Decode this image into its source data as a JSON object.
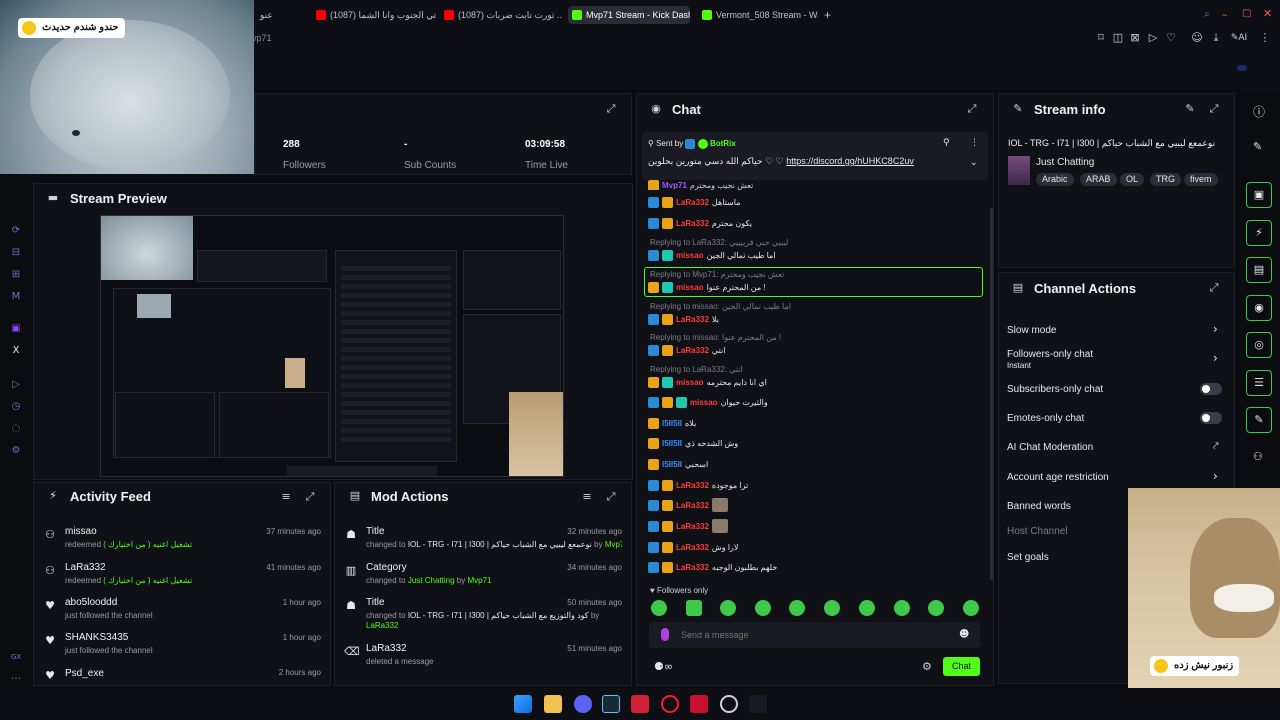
{
  "tabs": [
    {
      "label": "عنو"
    },
    {
      "label": "(1087) اتي الجنوب وانا الشما"
    },
    {
      "label": "(1087) ثورت تابت ضربات ..."
    },
    {
      "label": "Mvp71 Stream - Kick Dash"
    },
    {
      "label": "Vermont_508 Stream - Wa"
    }
  ],
  "url_fragment": "vp71",
  "webcam": {
    "caption": "حندو شندم حديدث"
  },
  "stats": {
    "followers_value": "288",
    "followers_label": "Followers",
    "subs_value": "-",
    "subs_label": "Sub Counts",
    "time_value": "03:09:58",
    "time_label": "Time Live"
  },
  "preview": {
    "title": "Stream Preview"
  },
  "activity": {
    "title": "Activity Feed",
    "items": [
      {
        "user": "missao",
        "action": "redeemed",
        "reward": "تشغيل اغنيه ( من اختيارك )",
        "time": "37 minutes ago"
      },
      {
        "user": "LaRa332",
        "action": "redeemed",
        "reward": "تشغيل اغنيه ( من اختيارك )",
        "time": "41 minutes ago"
      },
      {
        "user": "abo5looddd",
        "action": "just followed the channel",
        "reward": "",
        "time": "1 hour ago"
      },
      {
        "user": "SHANKS3435",
        "action": "just followed the channel",
        "reward": "",
        "time": "1 hour ago"
      },
      {
        "user": "Psd_exe",
        "action": "",
        "reward": "",
        "time": "2 hours ago"
      }
    ]
  },
  "mod": {
    "title": "Mod Actions",
    "items": [
      {
        "head": "Title",
        "pre": "changed to",
        "detail": "IOL - TRG - I71 | I300 | نوعمعع ليبيي مع الشباب حياكم",
        "by": "by",
        "who": "Mvp71",
        "time": "32 minutes ago"
      },
      {
        "head": "Category",
        "pre": "changed to",
        "detail": "Just Chatting",
        "by": "by",
        "who": "Mvp71",
        "time": "34 minutes ago"
      },
      {
        "head": "Title",
        "pre": "changed to",
        "detail": "IOL - TRG - I71 | I300 | كود والتوزيع مع الشباب حياكم",
        "by": "by",
        "who": "LaRa332",
        "time": "50 minutes ago"
      },
      {
        "head": "LaRa332",
        "pre": "deleted a message",
        "detail": "",
        "by": "",
        "who": "",
        "time": "51 minutes ago"
      }
    ]
  },
  "chat": {
    "title": "Chat",
    "pinned_label": "Sent by",
    "pinned_user": "BotRix",
    "pinned_text": "حياكم الله دسي متورين بحلوين",
    "pinned_link": "https://discord.gg/hUHKC8C2uv",
    "messages": [
      {
        "reply": "",
        "user": "Mvp71",
        "color": "#9b59ff",
        "text": "تعش نجيب ومحترم"
      },
      {
        "reply": "",
        "user": "LaRa332",
        "color": "#ff3b3b",
        "text": "ماستاهل"
      },
      {
        "reply": "",
        "user": "LaRa332",
        "color": "#ff3b3b",
        "text": "يكون محترم"
      },
      {
        "reply": "Replying to LaRa332: ليبيي حبي قرييييي",
        "user": "missao",
        "color": "#ff3b3b",
        "text": "اما طيب تمالي الجين"
      },
      {
        "reply": "Replying to Mvp71: تعش نجيب ومحترم",
        "user": "missao",
        "color": "#ff3b3b",
        "text": "من المحترم عنوا !"
      },
      {
        "reply": "Replying to missao: اما طيب تمالي الجين",
        "user": "LaRa332",
        "color": "#ff3b3b",
        "text": "بلا"
      },
      {
        "reply": "Replying to missao: من المحترم عنوا !",
        "user": "LaRa332",
        "color": "#ff3b3b",
        "text": "انتي"
      },
      {
        "reply": "Replying to LaRa332: انتي",
        "user": "missao",
        "color": "#ff3b3b",
        "text": "اي انا دايم محترمه"
      },
      {
        "reply": "",
        "user": "missao",
        "color": "#ff3b3b",
        "text": "والثيرت حيوان"
      },
      {
        "reply": "",
        "user": "I5II5II",
        "color": "#3a8cff",
        "text": "بلاه"
      },
      {
        "reply": "",
        "user": "I5II5II",
        "color": "#3a8cff",
        "text": "وش الشدحه ذي"
      },
      {
        "reply": "",
        "user": "I5II5II",
        "color": "#3a8cff",
        "text": "اسحبي"
      },
      {
        "reply": "",
        "user": "LaRa332",
        "color": "#ff3b3b",
        "text": "ترا موجوده"
      },
      {
        "reply": "",
        "user": "LaRa332",
        "color": "#ff3b3b",
        "text": ""
      },
      {
        "reply": "",
        "user": "LaRa332",
        "color": "#ff3b3b",
        "text": ""
      },
      {
        "reply": "",
        "user": "LaRa332",
        "color": "#ff3b3b",
        "text": "لارا وش"
      },
      {
        "reply": "",
        "user": "LaRa332",
        "color": "#ff3b3b",
        "text": "خلهم بطلبون الوجبه"
      }
    ],
    "followers_only": "Followers only",
    "input_placeholder": "Send a message",
    "send_label": "Chat"
  },
  "stream_info": {
    "title": "Stream info",
    "stream_title": "IOL - TRG - I71 | I300 | نوعمعع ليبيي مع الشباب حياكم",
    "category": "Just Chatting",
    "tags": [
      "Arabic",
      "ARAB",
      "OL",
      "TRG",
      "fivem"
    ]
  },
  "channel_actions": {
    "title": "Channel Actions",
    "items": [
      {
        "label": "Slow mode",
        "sub": ""
      },
      {
        "label": "Followers-only chat",
        "sub": "Instant"
      },
      {
        "label": "Subscribers-only chat",
        "sub": ""
      },
      {
        "label": "Emotes-only chat",
        "sub": ""
      },
      {
        "label": "AI Chat Moderation",
        "sub": ""
      },
      {
        "label": "Account age restriction",
        "sub": ""
      },
      {
        "label": "Banned words",
        "sub": ""
      },
      {
        "label": "Host Channel",
        "sub": ""
      },
      {
        "label": "Set goals",
        "sub": ""
      }
    ]
  },
  "overlay": {
    "caption": "زنبور نيش زده"
  },
  "colors": {
    "accent": "#53fc18",
    "panel": "#101116",
    "bg": "#0b0c10"
  }
}
